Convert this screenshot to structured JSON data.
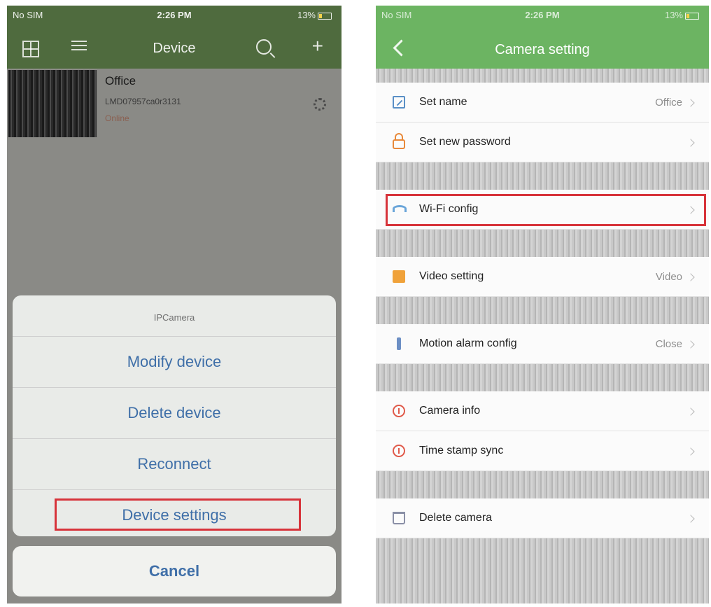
{
  "left_screen": {
    "status": {
      "carrier": "No SIM",
      "time": "2:26 PM",
      "battery": "13%"
    },
    "nav": {
      "title": "Device"
    },
    "device": {
      "name": "Office",
      "id": "LMD07957ca0r3131",
      "status": "Online"
    },
    "action_sheet": {
      "title": "IPCamera",
      "items": [
        "Modify device",
        "Delete device",
        "Reconnect",
        "Device settings"
      ],
      "cancel": "Cancel"
    }
  },
  "right_screen": {
    "status": {
      "carrier": "No SIM",
      "time": "2:26 PM",
      "battery": "13%"
    },
    "nav": {
      "title": "Camera setting"
    },
    "settings": [
      {
        "label": "Set name",
        "value": "Office",
        "icon": "edit-icon"
      },
      {
        "label": "Set new password",
        "value": "",
        "icon": "lock-icon"
      },
      {
        "label": "Wi-Fi config",
        "value": "",
        "icon": "wifi-icon"
      },
      {
        "label": "Video setting",
        "value": "Video",
        "icon": "video-icon"
      },
      {
        "label": "Motion alarm config",
        "value": "Close",
        "icon": "motion-icon"
      },
      {
        "label": "Camera info",
        "value": "",
        "icon": "info-icon"
      },
      {
        "label": "Time stamp sync",
        "value": "",
        "icon": "info-icon"
      },
      {
        "label": "Delete camera",
        "value": "",
        "icon": "trash-icon"
      }
    ]
  },
  "colors": {
    "left_nav": "#4f6b3e",
    "right_nav": "#6cb462",
    "action_text": "#3f6fa8",
    "highlight": "#d7333a"
  }
}
